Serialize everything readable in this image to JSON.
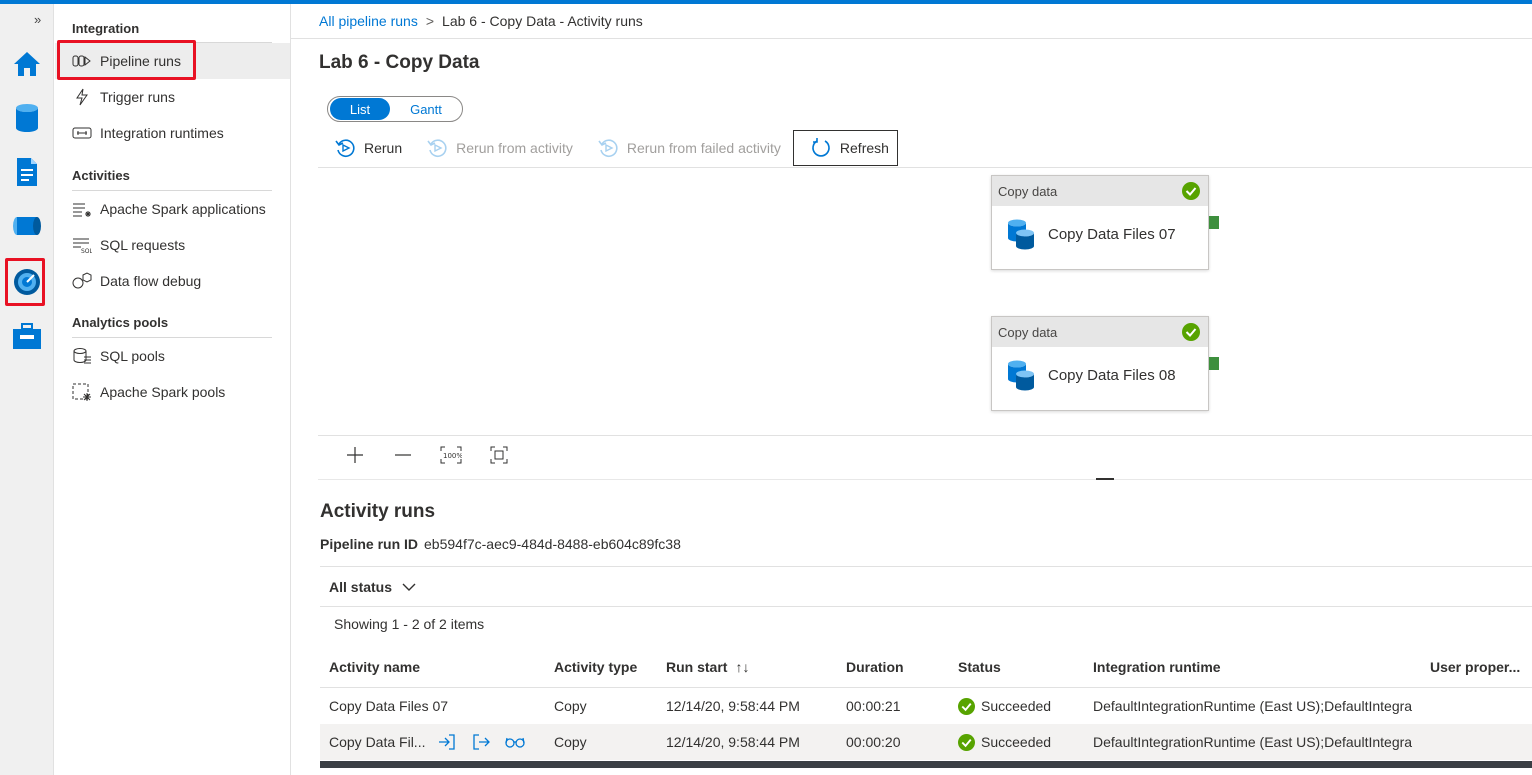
{
  "colors": {
    "accent": "#0078d4",
    "highlight": "#e81123",
    "success": "#57a300",
    "port": "#3d8f3d"
  },
  "rail": {
    "expand_label": "»",
    "icons": [
      "home-icon",
      "data-icon",
      "develop-icon",
      "integrate-icon",
      "monitor-icon",
      "manage-icon"
    ]
  },
  "nav": {
    "sections": [
      {
        "title": "Integration",
        "items": [
          "Pipeline runs",
          "Trigger runs",
          "Integration runtimes"
        ]
      },
      {
        "title": "Activities",
        "items": [
          "Apache Spark applications",
          "SQL requests",
          "Data flow debug"
        ]
      },
      {
        "title": "Analytics pools",
        "items": [
          "SQL pools",
          "Apache Spark pools"
        ]
      }
    ]
  },
  "breadcrumb": {
    "root": "All pipeline runs",
    "separator": ">",
    "current": "Lab 6 - Copy Data - Activity runs"
  },
  "page_title": "Lab 6 - Copy Data",
  "view_toggle": {
    "active": "List",
    "inactive": "Gantt"
  },
  "toolbar": {
    "rerun": "Rerun",
    "rerun_from_activity": "Rerun from activity",
    "rerun_from_failed": "Rerun from failed activity",
    "refresh": "Refresh"
  },
  "activities": [
    {
      "type": "Copy data",
      "name": "Copy Data Files 07"
    },
    {
      "type": "Copy data",
      "name": "Copy Data Files 08"
    }
  ],
  "activity_runs": {
    "title": "Activity runs",
    "run_id_label": "Pipeline run ID",
    "run_id": "eb594f7c-aec9-484d-8488-eb604c89fc38",
    "filter": "All status",
    "showing": "Showing 1 - 2 of 2 items",
    "columns": [
      "Activity name",
      "Activity type",
      "Run start",
      "Duration",
      "Status",
      "Integration runtime",
      "User proper..."
    ],
    "sort_indicator": "↑↓",
    "rows": [
      {
        "name": "Copy Data Files 07",
        "type": "Copy",
        "start": "12/14/20, 9:58:44 PM",
        "duration": "00:00:21",
        "status": "Succeeded",
        "runtime": "DefaultIntegrationRuntime (East US);DefaultIntegra"
      },
      {
        "name": "Copy Data Fil...",
        "type": "Copy",
        "start": "12/14/20, 9:58:44 PM",
        "duration": "00:00:20",
        "status": "Succeeded",
        "runtime": "DefaultIntegrationRuntime (East US);DefaultIntegra"
      }
    ]
  }
}
